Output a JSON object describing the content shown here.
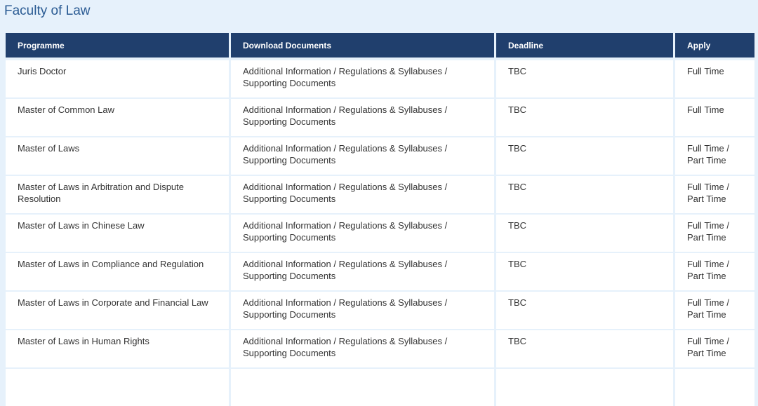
{
  "title": "Faculty of Law",
  "headers": [
    "Programme",
    "Download Documents",
    "Deadline",
    "Apply"
  ],
  "doc_links": [
    "Additional Information",
    "Regulations & Syllabuses",
    "Supporting Documents"
  ],
  "rows": [
    {
      "programme": "Juris Doctor",
      "deadline": "TBC",
      "apply": [
        "Full Time"
      ]
    },
    {
      "programme": "Master of Common Law",
      "deadline": "TBC",
      "apply": [
        "Full Time"
      ]
    },
    {
      "programme": "Master of Laws",
      "deadline": "TBC",
      "apply": [
        "Full Time",
        "Part Time"
      ]
    },
    {
      "programme": "Master of Laws in Arbitration and Dispute Resolution",
      "deadline": "TBC",
      "apply": [
        "Full Time",
        "Part Time"
      ]
    },
    {
      "programme": "Master of Laws in Chinese Law",
      "deadline": "TBC",
      "apply": [
        "Full Time",
        "Part Time"
      ]
    },
    {
      "programme": "Master of Laws in Compliance and Regulation",
      "deadline": "TBC",
      "apply": [
        "Full Time",
        "Part Time"
      ]
    },
    {
      "programme": "Master of Laws in Corporate and Financial Law",
      "deadline": "TBC",
      "apply": [
        "Full Time",
        "Part Time"
      ]
    },
    {
      "programme": "Master of Laws in Human Rights",
      "deadline": "TBC",
      "apply": [
        "Full Time",
        "Part Time"
      ]
    },
    {
      "programme": "",
      "deadline": "",
      "apply": []
    }
  ]
}
